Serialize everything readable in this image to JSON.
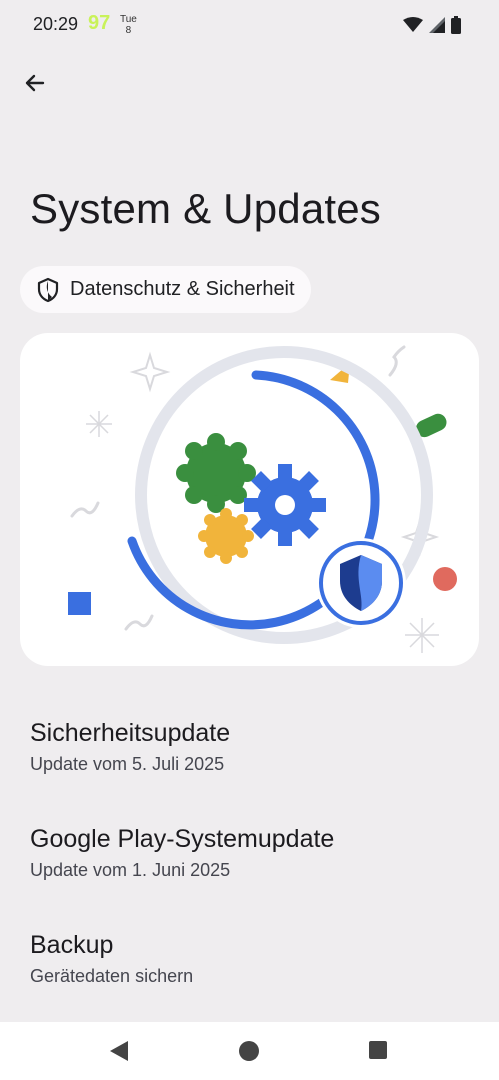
{
  "status": {
    "time": "20:29",
    "battery_level": "97",
    "day": "Tue",
    "date": "8"
  },
  "page": {
    "title": "System & Updates"
  },
  "chip": {
    "label": "Datenschutz & Sicherheit"
  },
  "items": [
    {
      "title": "Sicherheitsupdate",
      "subtitle": "Update vom 5. Juli 2025"
    },
    {
      "title": "Google Play-Systemupdate",
      "subtitle": "Update vom 1. Juni 2025"
    },
    {
      "title": "Backup",
      "subtitle": "Gerätedaten sichern"
    }
  ],
  "colors": {
    "blue": "#3a6fe0",
    "green": "#3a8f3f",
    "yellow": "#f1b43b",
    "red": "#e06a5e"
  }
}
